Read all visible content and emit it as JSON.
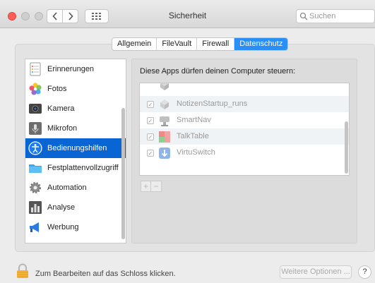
{
  "window": {
    "title": "Sicherheit"
  },
  "search": {
    "placeholder": "Suchen"
  },
  "tabs": [
    {
      "label": "Allgemein",
      "active": false
    },
    {
      "label": "FileVault",
      "active": false
    },
    {
      "label": "Firewall",
      "active": false
    },
    {
      "label": "Datenschutz",
      "active": true
    }
  ],
  "sidebar": {
    "items": [
      {
        "label": "Erinnerungen",
        "icon": "reminders-icon",
        "selected": false
      },
      {
        "label": "Fotos",
        "icon": "photos-icon",
        "selected": false
      },
      {
        "label": "Kamera",
        "icon": "camera-icon",
        "selected": false
      },
      {
        "label": "Mikrofon",
        "icon": "microphone-icon",
        "selected": false
      },
      {
        "label": "Bedienungshilfen",
        "icon": "accessibility-icon",
        "selected": true
      },
      {
        "label": "Festplattenvollzugriff",
        "icon": "folder-icon",
        "selected": false
      },
      {
        "label": "Automation",
        "icon": "gear-icon",
        "selected": false
      },
      {
        "label": "Analyse",
        "icon": "analytics-icon",
        "selected": false
      },
      {
        "label": "Werbung",
        "icon": "megaphone-icon",
        "selected": false
      }
    ]
  },
  "panel": {
    "heading": "Diese Apps dürfen deinen Computer steuern:",
    "apps": [
      {
        "label": "NotizenStartup_runs",
        "checked": true,
        "icon": "app-generic-icon"
      },
      {
        "label": "SmartNav",
        "checked": true,
        "icon": "smartnav-icon"
      },
      {
        "label": "TalkTable",
        "checked": true,
        "icon": "talktable-icon"
      },
      {
        "label": "VirtuSwitch",
        "checked": true,
        "icon": "virtuswitch-icon"
      }
    ],
    "add_label": "+",
    "remove_label": "−"
  },
  "footer": {
    "lock_text": "Zum Bearbeiten auf das Schloss klicken.",
    "more_button": "Weitere Optionen ...",
    "help_button": "?"
  },
  "colors": {
    "accent": "#2a8ef7",
    "selection": "#0a65d4",
    "close": "#ff5f57"
  }
}
